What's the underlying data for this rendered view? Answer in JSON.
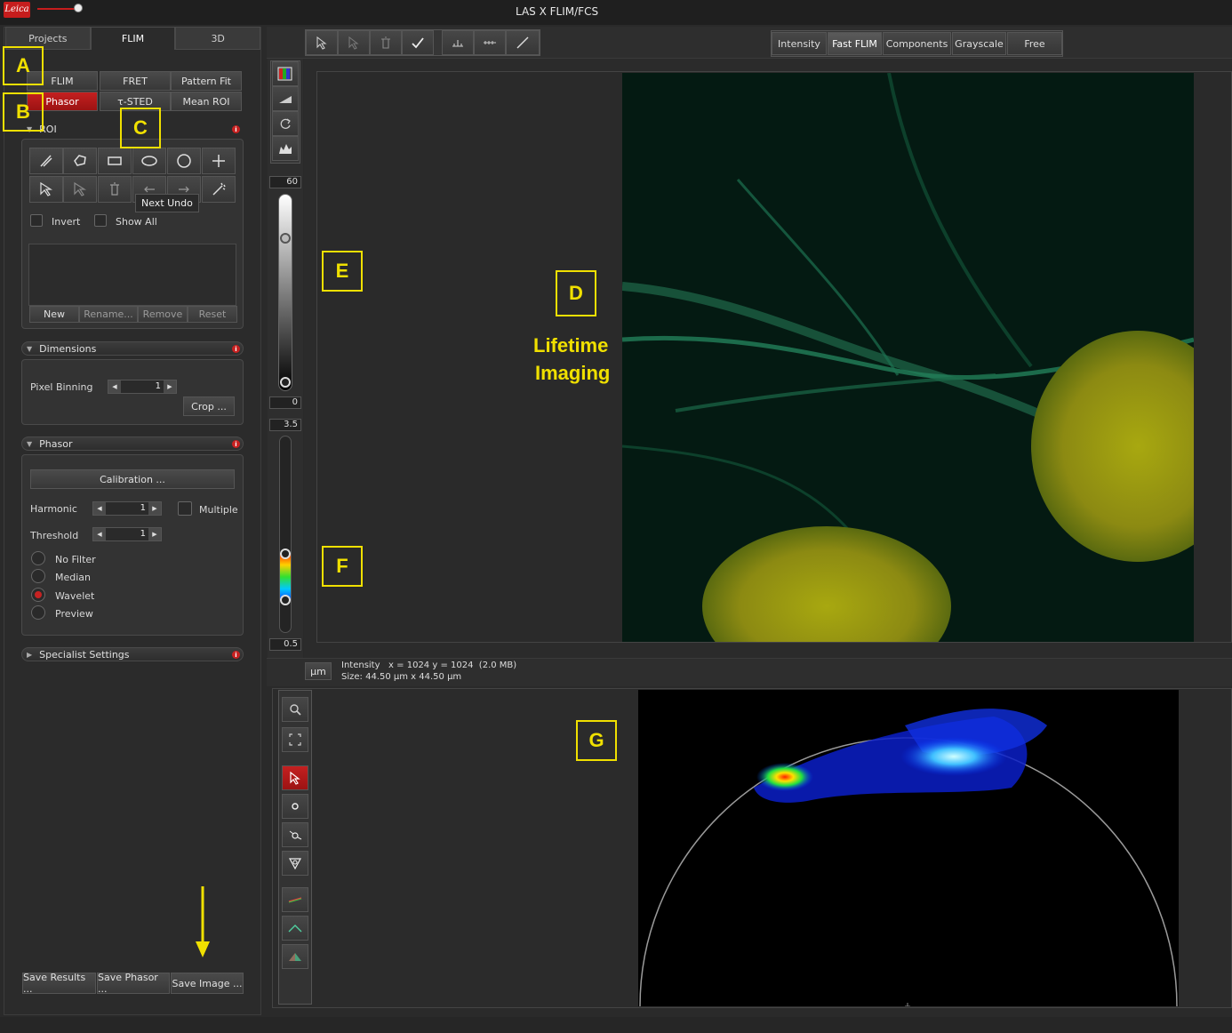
{
  "window": {
    "title": "LAS X FLIM/FCS",
    "logo_text": "Leica"
  },
  "left_tabs": [
    "Projects",
    "FLIM",
    "3D"
  ],
  "mode_buttons_row1": [
    "FLIM",
    "FRET",
    "Pattern Fit"
  ],
  "mode_buttons_row2": [
    "Phasor",
    "τ-STED",
    "Mean ROI"
  ],
  "roi": {
    "title": "ROI",
    "tooltip": "Next Undo",
    "invert_label": "Invert",
    "show_all_label": "Show All",
    "buttons": [
      "New",
      "Rename...",
      "Remove",
      "Reset"
    ]
  },
  "dimensions": {
    "title": "Dimensions",
    "pixel_binning_label": "Pixel Binning",
    "pixel_binning_value": "1",
    "crop_label": "Crop ..."
  },
  "phasor": {
    "title": "Phasor",
    "calibration_label": "Calibration ...",
    "harmonic_label": "Harmonic",
    "harmonic_value": "1",
    "multiple_label": "Multiple",
    "threshold_label": "Threshold",
    "threshold_value": "1",
    "filters": [
      "No Filter",
      "Median",
      "Wavelet",
      "Preview"
    ],
    "selected_filter": "Wavelet"
  },
  "specialist": {
    "title": "Specialist Settings"
  },
  "save_buttons": [
    "Save Results ...",
    "Save Phasor ...",
    "Save Image ..."
  ],
  "view_modes": [
    "Intensity",
    "Fast FLIM",
    "Components",
    "Grayscale",
    "Free"
  ],
  "active_view_mode": "Fast FLIM",
  "intensity_scale": {
    "max": "60",
    "min": "0"
  },
  "lifetime_scale": {
    "max": "3.5",
    "min": "0.5"
  },
  "status": {
    "unit_button": "µm",
    "line1": "Intensity   x = 1024 y = 1024  (2.0 MB)",
    "line2": "Size: 44.50 µm x 44.50 µm"
  },
  "annotations": {
    "labels": [
      "A",
      "B",
      "C",
      "D",
      "E",
      "F",
      "G"
    ],
    "d_text_line1": "Lifetime",
    "d_text_line2": "Imaging"
  },
  "colors": {
    "accent_red": "#c42020",
    "annotation_yellow": "#f0e000"
  }
}
